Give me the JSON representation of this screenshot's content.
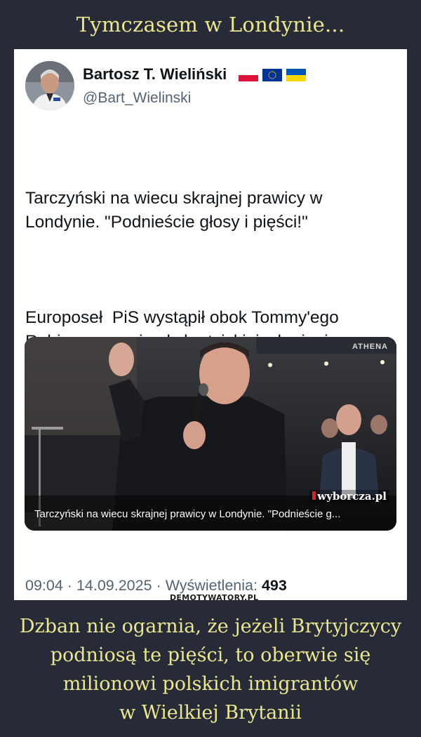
{
  "header": {
    "title": "Tymczasem w Londynie..."
  },
  "tweet": {
    "author_name": "Bartosz T. Wieliński",
    "author_handle": "@Bart_Wielinski",
    "flags": [
      "flag-poland",
      "flag-eu",
      "flag-ukraine"
    ],
    "text_paragraphs": [
      "Tarczyński na wiecu skrajnej prawicy w\nLondynie. \"Podnieście głosy i pięści!\"",
      "Europoseł  PiS wystąpił obok Tommy'ego\nRobinsona, gwiazdy brytyjskiej  skrajnej\nprawicy, któremu media wytykały związki z\nMoskwą"
    ],
    "media": {
      "caption": "Tarczyński na wiecu skrajnej prawicy w Londynie. \"Podnieście g...",
      "source": "wyborcza.pl",
      "overlay_text": "ATHENA"
    },
    "meta": {
      "time": "09:04",
      "date": "14.09.2025",
      "views_label": "Wyświetlenia:",
      "views_count": "493",
      "separator": "·"
    }
  },
  "watermark": "DEMOTYWATORY.PL",
  "caption_lines": [
    "Dzban nie ogarnia, że jeżeli Brytyjczycy",
    "podniosą te pięści, to oberwie się",
    "milionowi polskich imigrantów",
    "w Wielkiej Brytanii"
  ]
}
